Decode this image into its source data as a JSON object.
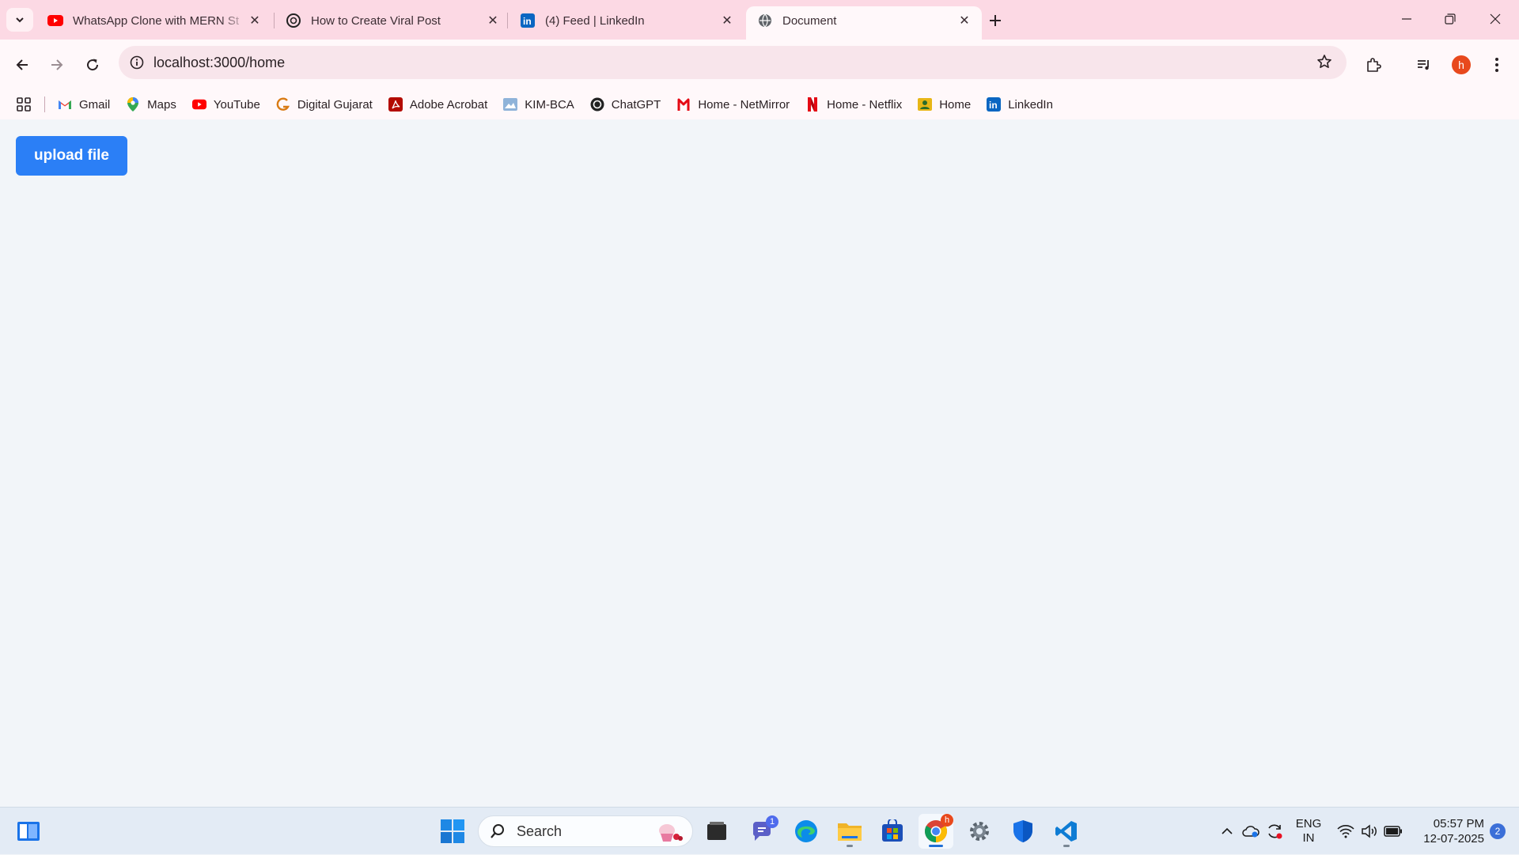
{
  "browser": {
    "tabs": [
      {
        "title": "WhatsApp Clone with MERN St",
        "favicon": "youtube-icon",
        "active": false
      },
      {
        "title": "How to Create Viral Post",
        "favicon": "chatgpt-icon",
        "active": false
      },
      {
        "title": "(4) Feed | LinkedIn",
        "favicon": "linkedin-icon",
        "active": false
      },
      {
        "title": "Document",
        "favicon": "globe-icon",
        "active": true
      }
    ],
    "address": "localhost:3000/home",
    "profile_initial": "h",
    "bookmarks": [
      {
        "label": "Gmail",
        "icon": "gmail-icon"
      },
      {
        "label": "Maps",
        "icon": "maps-icon"
      },
      {
        "label": "YouTube",
        "icon": "youtube-icon"
      },
      {
        "label": "Digital Gujarat",
        "icon": "digital-gujarat-icon"
      },
      {
        "label": "Adobe Acrobat",
        "icon": "acrobat-icon"
      },
      {
        "label": "KIM-BCA",
        "icon": "image-icon"
      },
      {
        "label": "ChatGPT",
        "icon": "chatgpt-icon"
      },
      {
        "label": "Home - NetMirror",
        "icon": "netmirror-icon"
      },
      {
        "label": "Home - Netflix",
        "icon": "netflix-icon"
      },
      {
        "label": "Home",
        "icon": "home-icon"
      },
      {
        "label": "LinkedIn",
        "icon": "linkedin-icon"
      }
    ]
  },
  "page": {
    "upload_button_label": "upload file"
  },
  "taskbar": {
    "search_label": "Search",
    "teams_badge": "1",
    "language_line1": "ENG",
    "language_line2": "IN",
    "time": "05:57 PM",
    "date": "12-07-2025",
    "notification_count": "2"
  },
  "colors": {
    "tabstrip_bg": "#fcd9e4",
    "toolbar_bg": "#fff8fa",
    "page_bg": "#f2f5f9",
    "upload_button_bg": "#2b7ff6",
    "avatar_bg": "#e8491d"
  }
}
